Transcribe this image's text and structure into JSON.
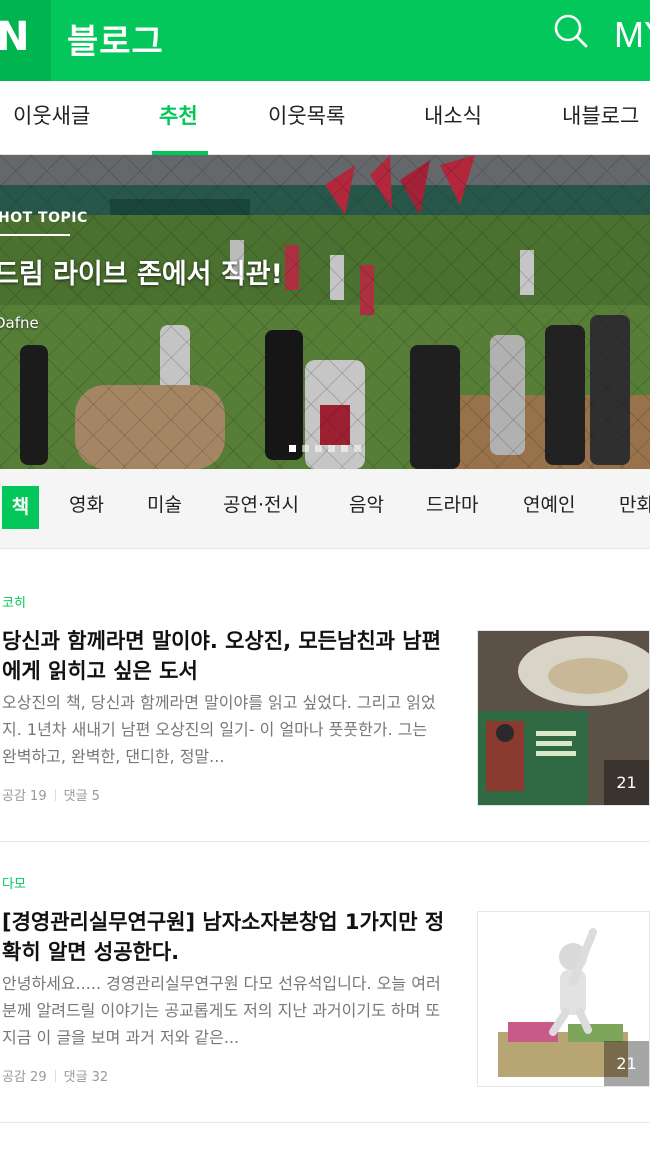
{
  "header": {
    "logo": "N",
    "title": "블로그",
    "search_icon": "search-icon",
    "my_label": "MY",
    "brand_color": "#03c75a"
  },
  "tabs": [
    {
      "label": "이웃새글",
      "active": false
    },
    {
      "label": "추천",
      "active": true
    },
    {
      "label": "이웃목록",
      "active": false
    },
    {
      "label": "내소식",
      "active": false
    },
    {
      "label": "내블로그",
      "active": false
    }
  ],
  "banner": {
    "tag": "HOT TOPIC",
    "title": "드림 라이브 존에서 직관!",
    "author": "Dafne",
    "slide_count": 6,
    "active_slide": 0
  },
  "categories": [
    {
      "label": "책",
      "active": true
    },
    {
      "label": "영화",
      "active": false
    },
    {
      "label": "미술",
      "active": false
    },
    {
      "label": "공연·전시",
      "active": false
    },
    {
      "label": "음악",
      "active": false
    },
    {
      "label": "드라마",
      "active": false
    },
    {
      "label": "연예인",
      "active": false
    },
    {
      "label": "만화",
      "active": false
    }
  ],
  "posts": [
    {
      "author": "코히",
      "title": "당신과 함께라면 말이야. 오상진, 모든남친과 남편에게 읽히고 싶은 도서",
      "description": "오상진의 책, 당신과 함께라면 말이야를 읽고 싶었다. 그리고 읽었지. 1년차 새내기 남편 오상진의 일기- 이 얼마나 풋풋한가. 그는 완벽하고, 완벽한, 댄디한, 정말...",
      "likes_label": "공감 19",
      "comments_label": "댓글 5",
      "image_count": "21"
    },
    {
      "author": "다모",
      "title": "[경영관리실무연구원] 남자소자본창업 1가지만 정확히 알면 성공한다.",
      "description": "안녕하세요..... 경영관리실무연구원 다모 선유석입니다. 오늘 여러분께 알려드릴 이야기는 공교롭게도 저의 지난 과거이기도 하며 또 지금 이 글을 보며 과거 저와 같은...",
      "likes_label": "공감 29",
      "comments_label": "댓글 32",
      "image_count": "21"
    }
  ]
}
